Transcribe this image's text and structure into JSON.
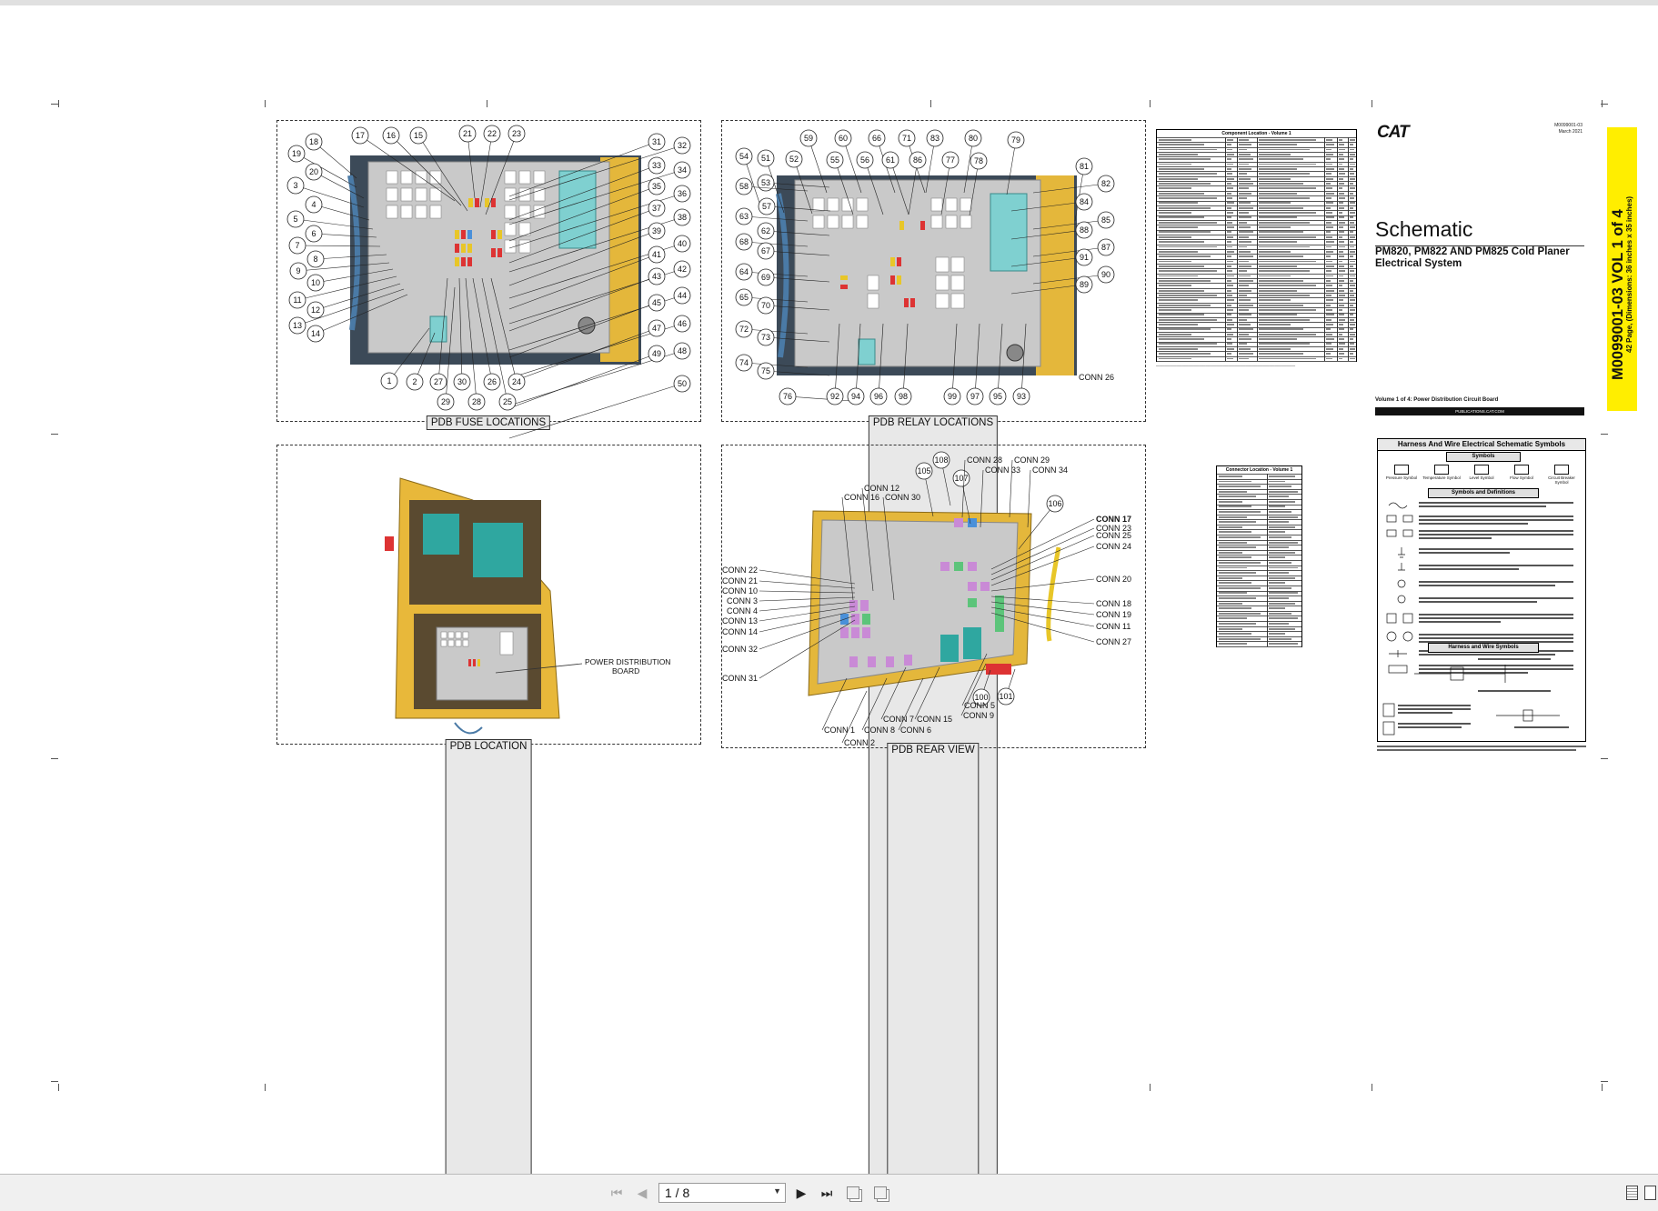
{
  "panels": {
    "fuse": {
      "title": "PDB FUSE LOCATIONS",
      "callouts": [
        "18",
        "19",
        "20",
        "3",
        "4",
        "5",
        "6",
        "7",
        "8",
        "9",
        "10",
        "11",
        "12",
        "13",
        "14",
        "17",
        "16",
        "15",
        "21",
        "22",
        "23",
        "31",
        "32",
        "33",
        "34",
        "35",
        "36",
        "37",
        "38",
        "39",
        "40",
        "41",
        "42",
        "43",
        "44",
        "45",
        "46",
        "47",
        "48",
        "49",
        "50",
        "1",
        "2",
        "27",
        "29",
        "30",
        "28",
        "26",
        "25",
        "24"
      ]
    },
    "relay": {
      "title": "PDB RELAY LOCATIONS",
      "callouts": [
        "59",
        "60",
        "66",
        "71",
        "83",
        "80",
        "79",
        "54",
        "51",
        "52",
        "55",
        "56",
        "61",
        "86",
        "77",
        "78",
        "53",
        "58",
        "57",
        "63",
        "62",
        "68",
        "67",
        "64",
        "69",
        "65",
        "70",
        "72",
        "73",
        "74",
        "75",
        "81",
        "82",
        "84",
        "85",
        "88",
        "87",
        "91",
        "90",
        "89",
        "76",
        "92",
        "94",
        "96",
        "98",
        "99",
        "97",
        "95",
        "93"
      ],
      "conn_label": "CONN 26"
    },
    "location": {
      "title": "PDB  LOCATION",
      "board_label_1": "POWER DISTRIBUTION",
      "board_label_2": "BOARD"
    },
    "rear": {
      "title": "PDB REAR VIEW",
      "callouts": [
        "108",
        "105",
        "107",
        "106",
        "100",
        "101"
      ],
      "left_labels": [
        "CONN 22",
        "CONN 21",
        "CONN 10",
        "CONN 3",
        "CONN 4",
        "CONN 13",
        "CONN 14",
        "CONN 32",
        "CONN 31"
      ],
      "top_labels": [
        "CONN 12",
        "CONN 16",
        "CONN 30",
        "CONN 28",
        "CONN 33",
        "CONN 29",
        "CONN 34"
      ],
      "right_labels": [
        "CONN 17",
        "CONN 23",
        "CONN 25",
        "CONN 24",
        "CONN 20",
        "CONN 18",
        "CONN 19",
        "CONN 11",
        "CONN 27"
      ],
      "bottom_labels": [
        "CONN 1",
        "CONN 2",
        "CONN 8",
        "CONN 6",
        "CONN 7",
        "CONN 15",
        "CONN 5",
        "CONN 9"
      ]
    }
  },
  "component_table": {
    "title": "Component Location - Volume 1"
  },
  "connector_table": {
    "title": "Connector Location - Volume 1"
  },
  "title_block": {
    "brand": "CAT",
    "doc_number": "M0099001-03",
    "date": "March 2021",
    "heading": "Schematic",
    "subheading_1": "PM820, PM822 AND PM825 Cold Planer",
    "subheading_2": "Electrical System",
    "volume_line": "Volume 1 of 4: Power Distribution Circuit Board",
    "publications": "PUBLICATIONS.CAT.COM",
    "banner_main": "M0099001-03 VOL 1 of 4",
    "banner_sub": "42 Page, (Dimensions: 36 inches x 35 inches)"
  },
  "symbols_panel": {
    "title": "Harness And Wire Electrical Schematic Symbols",
    "symbols_header": "Symbols",
    "definitions_header": "Symbols and Definitions",
    "harness_header": "Harness and Wire Symbols",
    "symbol_names": [
      "Pressure Symbol",
      "Temperature Symbol",
      "Level Symbol",
      "Flow Symbol",
      "Circuit Breaker Symbol"
    ]
  },
  "toolbar": {
    "page_indicator": "1 / 8",
    "first_icon": "first-page-icon",
    "prev_icon": "prev-page-icon",
    "next_icon": "next-page-icon",
    "last_icon": "last-page-icon"
  }
}
